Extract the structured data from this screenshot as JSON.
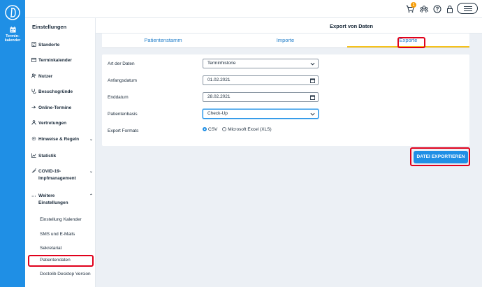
{
  "rail": {
    "nav_label_line1": "Termin-",
    "nav_label_line2": "kalender",
    "logo_icon": "doctolib-logo",
    "brand_color": "#1f8fe5"
  },
  "topbar": {
    "cart_badge": "1",
    "icons": [
      "cart-icon",
      "team-icon",
      "help-icon",
      "lock-icon",
      "menu-icon"
    ]
  },
  "sidebar": {
    "title": "Einstellungen",
    "items": [
      {
        "label": "Standorte",
        "icon": "building-icon"
      },
      {
        "label": "Terminkalender",
        "icon": "calendar-icon"
      },
      {
        "label": "Nutzer",
        "icon": "users-icon"
      },
      {
        "label": "Besuchsgründe",
        "icon": "stethoscope-icon"
      },
      {
        "label": "Online-Termine",
        "icon": "online-icon"
      },
      {
        "label": "Vertretungen",
        "icon": "person-icon"
      },
      {
        "label": "Hinweise & Regeln",
        "icon": "gear-icon"
      },
      {
        "label": "Statistik",
        "icon": "chart-icon"
      },
      {
        "label": "COVID-19-",
        "label2": "Impfmanagement",
        "icon": "syringe-icon"
      },
      {
        "label": "Weitere",
        "label2": "Einstellungen",
        "icon": "more-icon"
      }
    ],
    "sub_items": [
      "Einstellung Kalender",
      "SMS und E-Mails",
      "Sekretariat",
      "Patientendaten",
      "Doctolib Desktop Version"
    ]
  },
  "main": {
    "title": "Export von Daten",
    "tabs": [
      "Patientenstamm",
      "Importe",
      "Exporte"
    ],
    "active_tab": "Exporte",
    "form": {
      "type_label": "Art der Daten",
      "type_value": "Terminhistorie",
      "start_label": "Anfangsdatum",
      "start_value": "01.02.2021",
      "end_label": "Enddatum",
      "end_value": "28.02.2021",
      "basis_label": "Patientenbasis",
      "basis_value": "Check-Up",
      "formats_label": "Export Formats",
      "format_csv": "CSV",
      "format_xls": "Microsoft Excel (XLS)",
      "selected_format": "CSV"
    },
    "export_button": "DATEI EXPORTIEREN"
  },
  "colors": {
    "highlight": "#e0001b",
    "tab_active_underline": "#f7c21a",
    "link_blue": "#1f7dc9"
  }
}
